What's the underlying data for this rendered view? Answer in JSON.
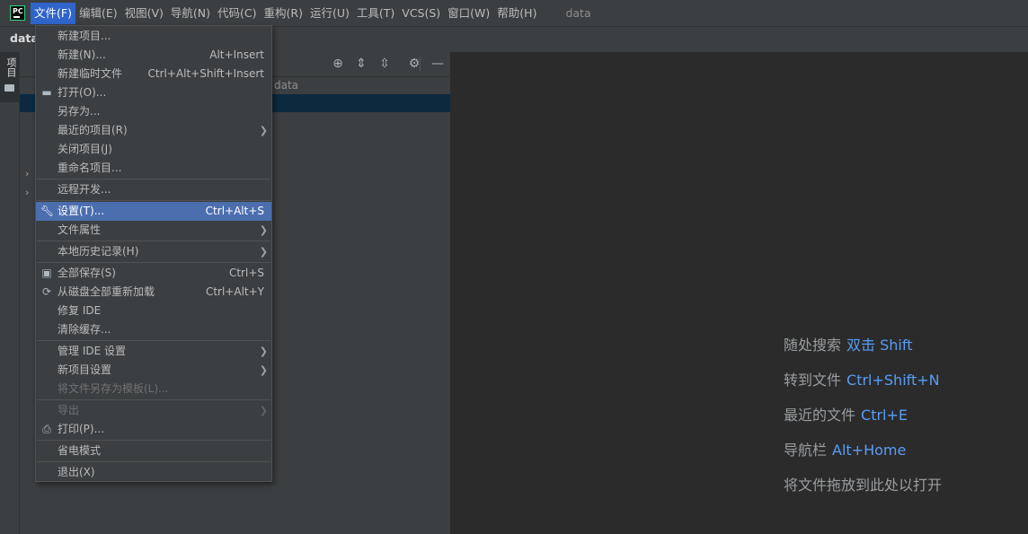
{
  "menubar": {
    "logo_text": "PC",
    "items": [
      {
        "label": "文件(F)",
        "active": true
      },
      {
        "label": "编辑(E)"
      },
      {
        "label": "视图(V)"
      },
      {
        "label": "导航(N)"
      },
      {
        "label": "代码(C)"
      },
      {
        "label": "重构(R)"
      },
      {
        "label": "运行(U)"
      },
      {
        "label": "工具(T)"
      },
      {
        "label": "VCS(S)"
      },
      {
        "label": "窗口(W)"
      },
      {
        "label": "帮助(H)"
      }
    ],
    "project_name": "data"
  },
  "navbar": {
    "crumb": "data"
  },
  "tool_strip": {
    "project_label": "项目"
  },
  "project_panel": {
    "tree_path": "data"
  },
  "file_menu": {
    "items": [
      {
        "label": "新建项目...",
        "shortcut": "",
        "icon": "",
        "submenu": false
      },
      {
        "label": "新建(N)...",
        "shortcut": "Alt+Insert",
        "icon": "",
        "submenu": false
      },
      {
        "label": "新建临时文件",
        "shortcut": "Ctrl+Alt+Shift+Insert",
        "icon": "",
        "submenu": false
      },
      {
        "label": "打开(O)...",
        "shortcut": "",
        "icon": "folder-icon",
        "submenu": false
      },
      {
        "label": "另存为...",
        "shortcut": "",
        "icon": "",
        "submenu": false
      },
      {
        "label": "最近的项目(R)",
        "shortcut": "",
        "icon": "",
        "submenu": true
      },
      {
        "label": "关闭项目(J)",
        "shortcut": "",
        "icon": "",
        "submenu": false
      },
      {
        "label": "重命名项目...",
        "shortcut": "",
        "icon": "",
        "submenu": false
      },
      {
        "label": "远程开发...",
        "shortcut": "",
        "icon": "",
        "submenu": false
      },
      {
        "label": "设置(T)...",
        "shortcut": "Ctrl+Alt+S",
        "icon": "wrench-icon",
        "submenu": false,
        "highlighted": true
      },
      {
        "label": "文件属性",
        "shortcut": "",
        "icon": "",
        "submenu": true
      },
      {
        "label": "本地历史记录(H)",
        "shortcut": "",
        "icon": "",
        "submenu": true
      },
      {
        "label": "全部保存(S)",
        "shortcut": "Ctrl+S",
        "icon": "save-icon",
        "submenu": false
      },
      {
        "label": "从磁盘全部重新加载",
        "shortcut": "Ctrl+Alt+Y",
        "icon": "reload-icon",
        "submenu": false
      },
      {
        "label": "修复 IDE",
        "shortcut": "",
        "icon": "",
        "submenu": false
      },
      {
        "label": "清除缓存...",
        "shortcut": "",
        "icon": "",
        "submenu": false
      },
      {
        "label": "管理 IDE 设置",
        "shortcut": "",
        "icon": "",
        "submenu": true
      },
      {
        "label": "新项目设置",
        "shortcut": "",
        "icon": "",
        "submenu": true
      },
      {
        "label": "将文件另存为模板(L)...",
        "shortcut": "",
        "icon": "",
        "submenu": false,
        "disabled": true
      },
      {
        "label": "导出",
        "shortcut": "",
        "icon": "",
        "submenu": true,
        "disabled": true
      },
      {
        "label": "打印(P)...",
        "shortcut": "",
        "icon": "print-icon",
        "submenu": false
      },
      {
        "label": "省电模式",
        "shortcut": "",
        "icon": "",
        "submenu": false
      },
      {
        "label": "退出(X)",
        "shortcut": "",
        "icon": "",
        "submenu": false
      }
    ]
  },
  "editor_hints": [
    {
      "text": "随处搜索",
      "key": "双击 Shift"
    },
    {
      "text": "转到文件",
      "key": "Ctrl+Shift+N"
    },
    {
      "text": "最近的文件",
      "key": "Ctrl+E"
    },
    {
      "text": "导航栏",
      "key": "Alt+Home"
    },
    {
      "text": "将文件拖放到此处以打开",
      "key": ""
    }
  ],
  "colors": {
    "menu_active": "#2f65ca",
    "menu_highlight": "#4b6eaf",
    "hint_key": "#589df6"
  }
}
